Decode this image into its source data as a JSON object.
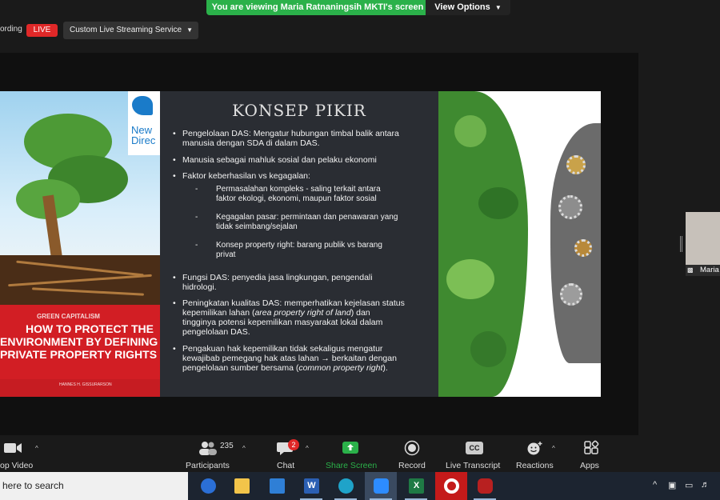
{
  "banner": {
    "viewing_text": "You are viewing Maria Ratnaningsih MKTI's screen",
    "view_options": "View Options"
  },
  "topbar": {
    "recording_label": "ording",
    "live_badge": "LIVE",
    "stream_service": "Custom Live Streaming Service"
  },
  "slide": {
    "title": "KONSEP PIKIR",
    "bullets": {
      "b1": "Pengelolaan DAS: Mengatur hubungan timbal balik antara",
      "b1b": "manusia dengan SDA di dalam DAS.",
      "b2": "Manusia sebagai mahluk sosial dan pelaku ekonomi",
      "b3": "Faktor keberhasilan vs kegagalan:",
      "s1": "Permasalahan kompleks - saling terkait antara",
      "s1b": "faktor ekologi, ekonomi, maupun faktor sosial",
      "s2": "Kegagalan pasar: permintaan dan penawaran yang",
      "s2b": "tidak seimbang/sejalan",
      "s3": "Konsep property right: barang publik vs barang",
      "s3b": "privat",
      "b4": "Fungsi DAS: penyedia jasa lingkungan,  pengendali",
      "b4b": "hidrologi.",
      "b5": "Peningkatan kualitas DAS: memperhatikan kejelasan status",
      "b5b_pre": "kepemilikan lahan (",
      "b5b_it": "area property right of land",
      "b5b_post": ") dan",
      "b5c": "tingginya potensi kepemilikan masyarakat lokal dalam",
      "b5d": "pengelolaan DAS.",
      "b6": "Pengakuan hak kepemilikan tidak sekaligus mengatur",
      "b6b": "kewajibab pemegang hak atas lahan → berkaitan dengan",
      "b6c_pre": "pengelolaan sumber bersama (",
      "b6c_it": "common property right",
      "b6c_post": ")."
    },
    "book": {
      "brand": "New Direc",
      "green_capitalism": "GREEN CAPITALISM",
      "line1": "HOW TO PROTECT THE",
      "line2": "ENVIRONMENT BY DEFINING",
      "line3": "PRIVATE PROPERTY RIGHTS",
      "author": "HANNES H. GISSURARSON"
    }
  },
  "participant": {
    "name": "Maria"
  },
  "toolbar": {
    "video_label": "op Video",
    "participants_label": "Participants",
    "participants_count": "235",
    "chat_label": "Chat",
    "chat_badge": "2",
    "share_label": "Share Screen",
    "record_label": "Record",
    "transcript_label": "Live Transcript",
    "cc_text": "CC",
    "reactions_label": "Reactions",
    "apps_label": "Apps"
  },
  "taskbar": {
    "search_placeholder": "here to search",
    "word_letter": "W",
    "excel_letter": "X"
  },
  "colors": {
    "banner_green": "#2bb14a",
    "live_red": "#e02828",
    "share_green": "#2bb14a",
    "book_red": "#d21e24"
  }
}
